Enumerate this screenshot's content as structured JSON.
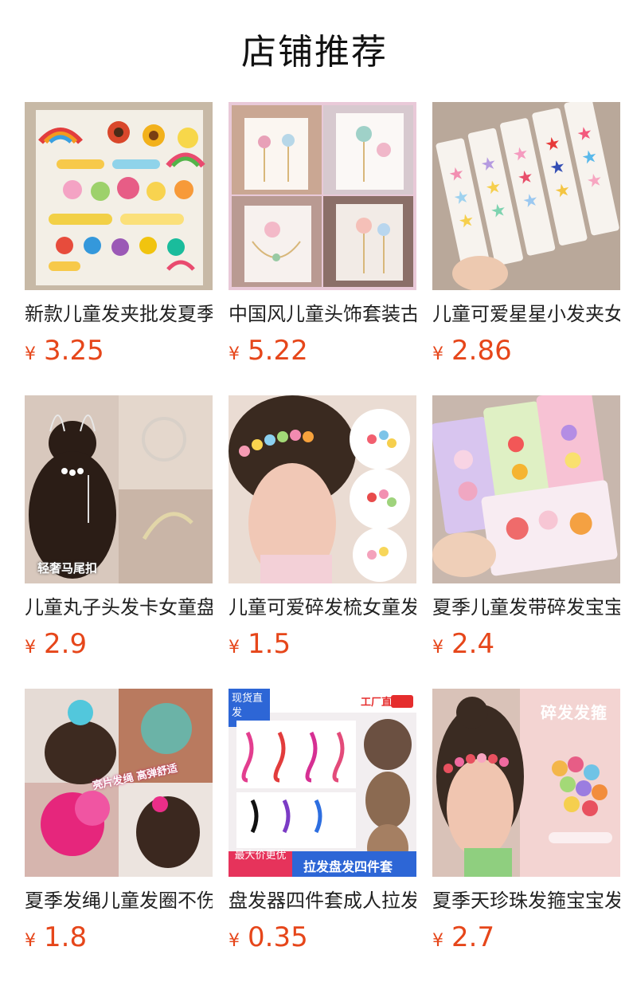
{
  "page": {
    "title": "店铺推荐"
  },
  "products": [
    {
      "title": "新款儿童发夹批发夏季",
      "currency": "¥",
      "price": "3.25",
      "image_icon": "hair-clips-rainbow-set-image"
    },
    {
      "title": "中国风儿童头饰套装古风",
      "currency": "¥",
      "price": "5.22",
      "image_icon": "chinese-style-hair-accessories-image"
    },
    {
      "title": "儿童可爱星星小发夹女",
      "currency": "¥",
      "price": "2.86",
      "image_icon": "star-hair-clips-image"
    },
    {
      "title": "儿童丸子头发卡女童盘",
      "currency": "¥",
      "price": "2.9",
      "image_icon": "bun-hairpin-image",
      "image_badge": "轻奢马尾扣"
    },
    {
      "title": "儿童可爱碎发梳女童发",
      "currency": "¥",
      "price": "1.5",
      "image_icon": "hair-comb-image"
    },
    {
      "title": "夏季儿童发带碎发宝宝",
      "currency": "¥",
      "price": "2.4",
      "image_icon": "hair-clip-cards-image"
    },
    {
      "title": "夏季发绳儿童发圈不伤",
      "currency": "¥",
      "price": "1.8",
      "image_icon": "sequin-hair-tie-image",
      "image_badge": "亮片发绳 高弹舒适"
    },
    {
      "title": "盘发器四件套成人拉发",
      "currency": "¥",
      "price": "0.35",
      "image_icon": "hair-styling-tool-set-image",
      "image_badge": "现货直发",
      "image_badge_2": "工厂直营",
      "image_badge_3": "最大价更优",
      "image_badge_4": "拉发盘发四件套"
    },
    {
      "title": "夏季天珍珠发箍宝宝发",
      "currency": "¥",
      "price": "2.7",
      "image_icon": "headband-image",
      "image_badge": "碎发发箍"
    }
  ]
}
